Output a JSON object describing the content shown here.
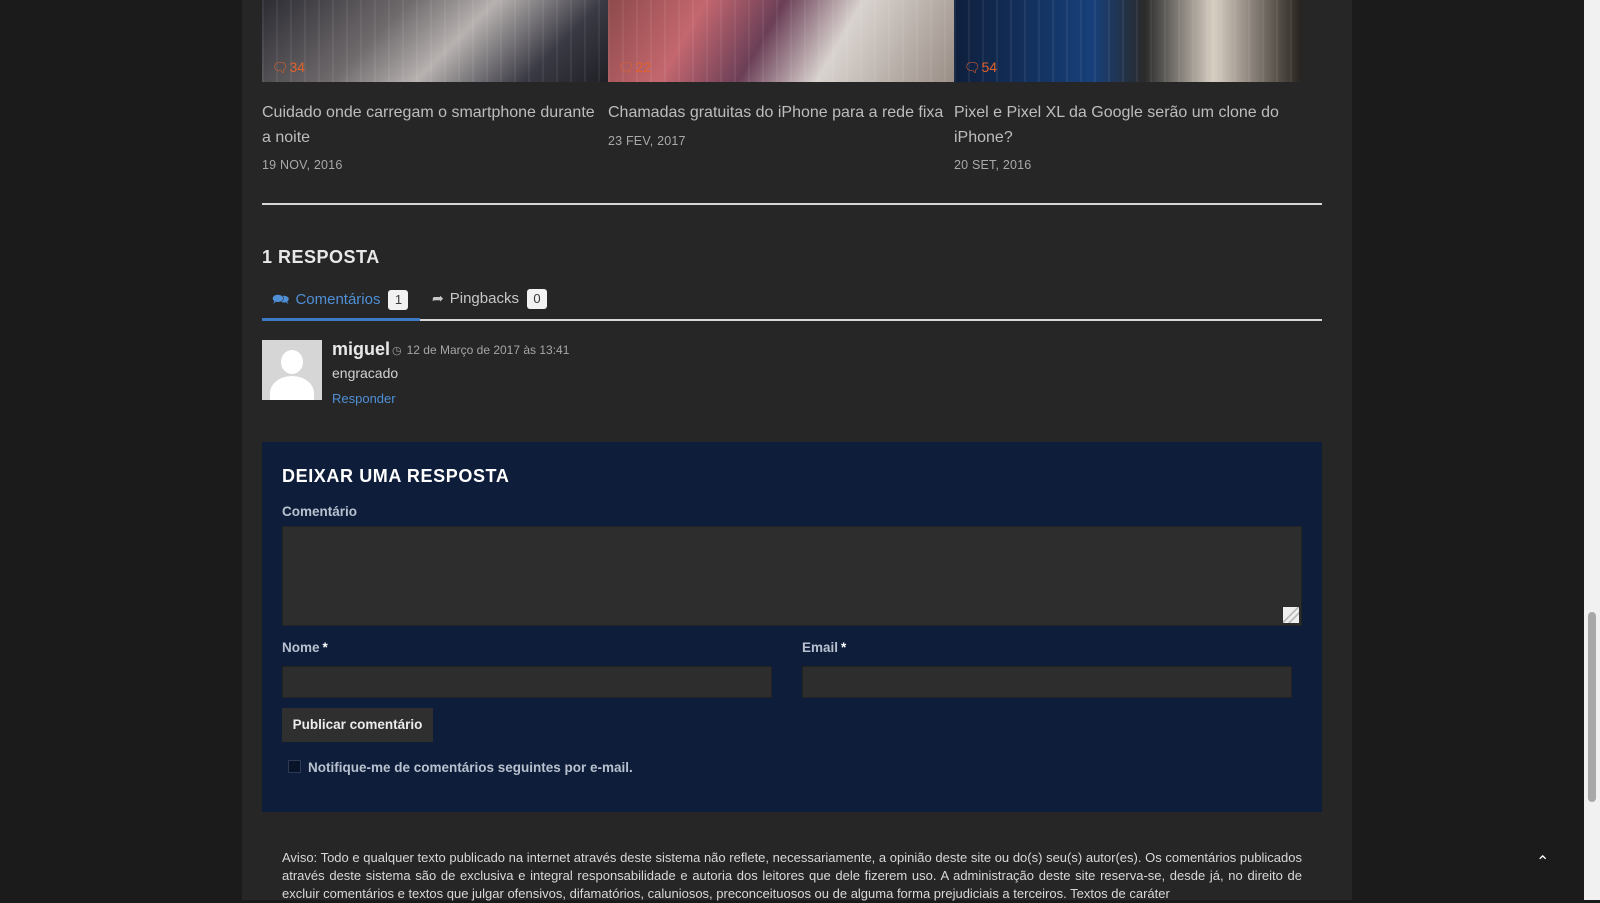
{
  "related_posts": [
    {
      "title": "Cuidado onde carregam o smartphone durante a noite",
      "date": "19 NOV, 2016",
      "comments": "34"
    },
    {
      "title": "Chamadas gratuitas do iPhone para a rede fixa",
      "date": "23 FEV, 2017",
      "comments": "22"
    },
    {
      "title": "Pixel e Pixel XL da Google serão um clone do iPhone?",
      "date": "20 SET, 2016",
      "comments": "54"
    }
  ],
  "responses": {
    "title": "1 RESPOSTA",
    "tabs": [
      {
        "label": "Comentários",
        "count": "1",
        "icon": "comment-icon"
      },
      {
        "label": "Pingbacks",
        "count": "0",
        "icon": "share-icon"
      }
    ]
  },
  "comment": {
    "author": "miguel",
    "time": "12 de Março de 2017 às 13:41",
    "text": "engracado",
    "reply_label": "Responder"
  },
  "reply_form": {
    "title": "DEIXAR UMA RESPOSTA",
    "comment_label": "Comentário",
    "name_label": "Nome",
    "email_label": "Email",
    "required_mark": "*",
    "submit_label": "Publicar comentário",
    "notify_label": "Notifique-me de comentários seguintes por e-mail."
  },
  "disclaimer": "Aviso: Todo e qualquer texto publicado na internet através deste sistema não reflete, necessariamente, a opinião deste site ou do(s) seu(s) autor(es). Os comentários publicados através deste sistema são de exclusiva e integral responsabilidade e autoria dos leitores que dele fizerem uso. A administração deste site reserva-se, desde já, no direito de excluir comentários e textos que julgar ofensivos, difamatórios, caluniosos, preconceituosos ou de alguma forma prejudiciais a terceiros. Textos de caráter",
  "colors": {
    "accent": "#4f8fd6",
    "form_background": "#0d1d3a",
    "comment_count": "#e2622c"
  }
}
